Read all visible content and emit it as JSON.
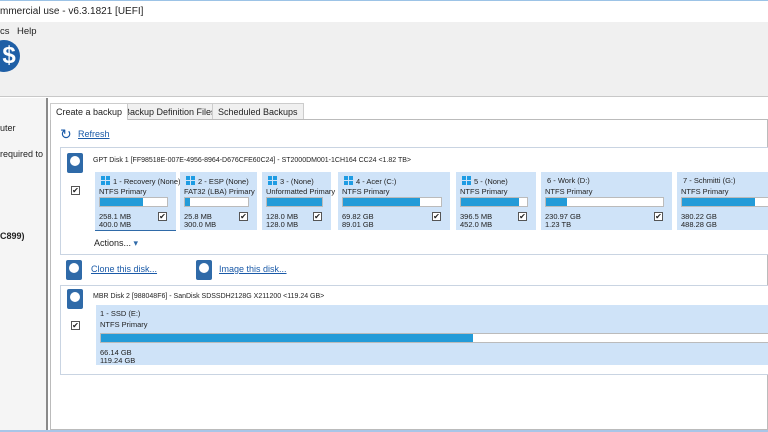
{
  "window": {
    "title": "mmercial use - v6.3.1821  [UEFI]"
  },
  "menu": {
    "items": [
      "cs",
      "Help"
    ]
  },
  "left_panel": {
    "lines": [
      "uter",
      "required to",
      "C899)"
    ]
  },
  "tabs": [
    "Create a backup",
    "Backup Definition Files",
    "Scheduled Backups"
  ],
  "refresh_label": "Refresh",
  "disk1": {
    "header": "GPT Disk 1 [FF98518E-007E-4956-8964-D676CFE60C24] - ST2000DM001-1CH164 CC24  <1.82 TB>",
    "partitions": [
      {
        "name": "1 - Recovery (None)",
        "type": "NTFS Primary",
        "used": "258.1 MB",
        "total": "400.0 MB",
        "fill": 0.645,
        "win": true,
        "checked": true
      },
      {
        "name": "2 - ESP (None)",
        "type": "FAT32 (LBA) Primary",
        "used": "25.8 MB",
        "total": "300.0 MB",
        "fill": 0.086,
        "win": true,
        "checked": true
      },
      {
        "name": "3 -  (None)",
        "type": "Unformatted Primary",
        "used": "128.0 MB",
        "total": "128.0 MB",
        "fill": 1.0,
        "win": true,
        "checked": true
      },
      {
        "name": "4 - Acer (C:)",
        "type": "NTFS Primary",
        "used": "69.82 GB",
        "total": "89.01 GB",
        "fill": 0.784,
        "win": true,
        "checked": true
      },
      {
        "name": "5 -  (None)",
        "type": "NTFS Primary",
        "used": "396.5 MB",
        "total": "452.0 MB",
        "fill": 0.877,
        "win": true,
        "checked": true
      },
      {
        "name": "6 - Work (D:)",
        "type": "NTFS Primary",
        "used": "230.97 GB",
        "total": "1.23 TB",
        "fill": 0.183,
        "win": false,
        "checked": true
      },
      {
        "name": "7 - Schmitti (G:)",
        "type": "NTFS Primary",
        "used": "380.22 GB",
        "total": "488.28 GB",
        "fill": 0.779,
        "win": false,
        "checked": false
      }
    ],
    "actions_label": "Actions..."
  },
  "disk_links": {
    "clone": "Clone this disk...",
    "image": "Image this disk..."
  },
  "disk2": {
    "header": "MBR Disk 2 [988048F6] - SanDisk SDSSDH2128G X211200  <119.24 GB>",
    "partition": {
      "name": "1 - SSD (E:)",
      "type": "NTFS Primary",
      "used": "66.14 GB",
      "total": "119.24 GB",
      "fill": 0.555
    }
  },
  "colors": {
    "accent": "#239bd8",
    "partition_bg": "#cfe3f8",
    "link": "#1a5aa8"
  }
}
